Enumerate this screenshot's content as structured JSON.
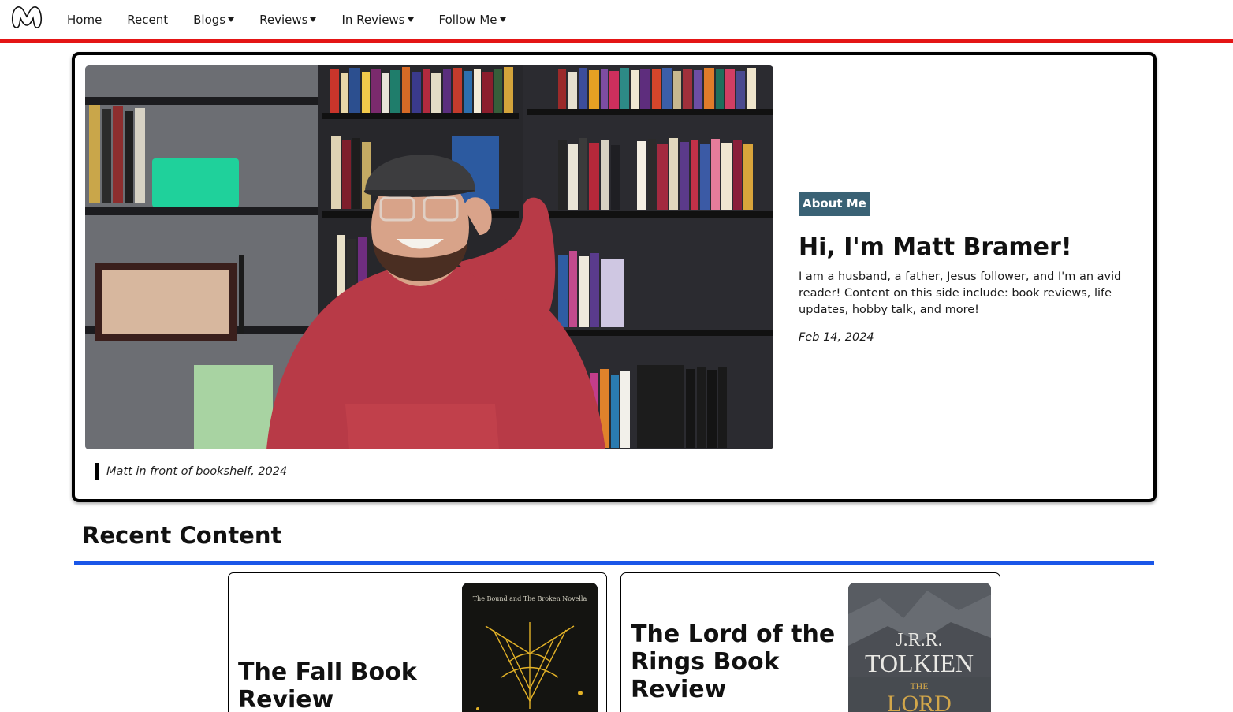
{
  "nav": {
    "logo_icon": "m-logo-icon",
    "items": [
      {
        "label": "Home",
        "has_caret": false
      },
      {
        "label": "Recent",
        "has_caret": false
      },
      {
        "label": "Blogs",
        "has_caret": true
      },
      {
        "label": "Reviews",
        "has_caret": true
      },
      {
        "label": "In Reviews",
        "has_caret": true
      },
      {
        "label": "Follow Me",
        "has_caret": true
      }
    ],
    "accent_color": "#e41515"
  },
  "hero": {
    "photo_caption": "Matt in front of bookshelf, 2024",
    "badge": "About Me",
    "title": "Hi, I'm Matt Bramer!",
    "description": "I am a husband, a father, Jesus follower, and I'm an avid reader! Content on this side include: book reviews, life updates, hobby talk, and more!",
    "date": "Feb 14, 2024",
    "badge_color": "#3a6275"
  },
  "recent": {
    "title": "Recent Content",
    "rule_color": "#1a56e8",
    "cards": [
      {
        "title": "The Fall Book Review",
        "cover_text": "The Bound and The Broken Novella"
      },
      {
        "title": "The Lord of the Rings Book Review",
        "cover_text_author_1": "J.R.R.",
        "cover_text_author_2": "TOLKIEN",
        "cover_text_the": "THE",
        "cover_text_lord": "LORD"
      }
    ]
  }
}
